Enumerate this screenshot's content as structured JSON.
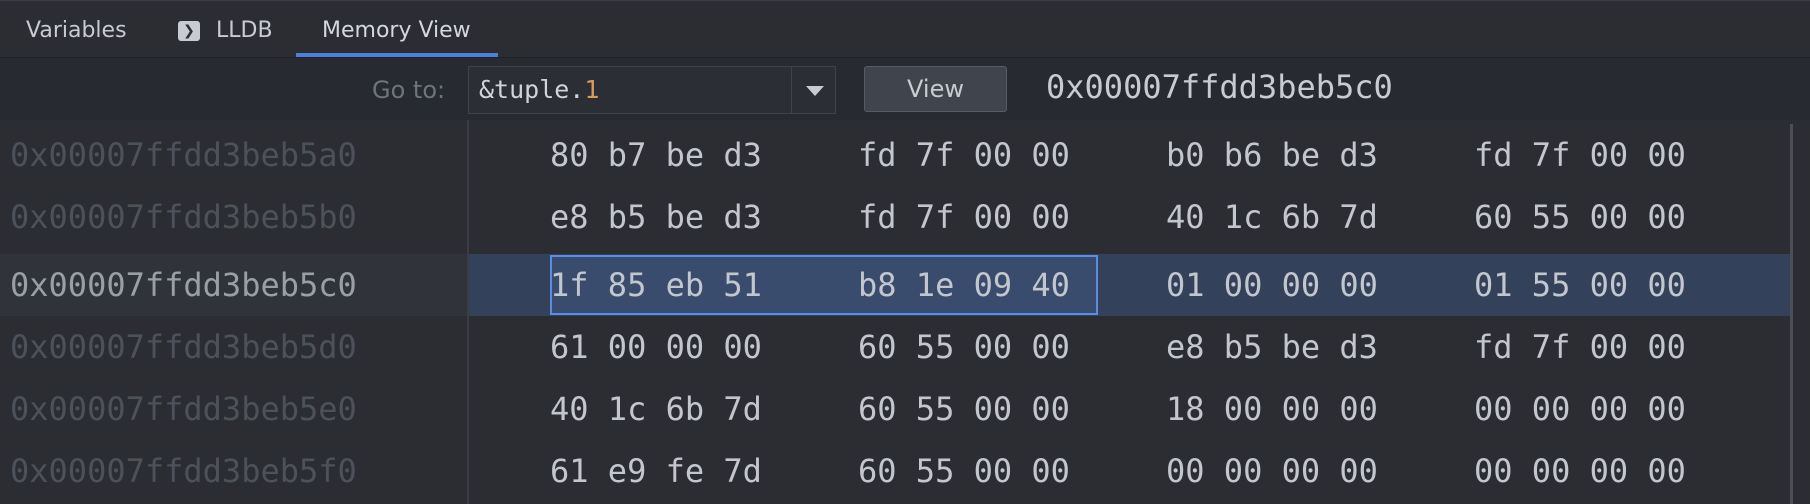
{
  "tabs": [
    {
      "label": "Variables"
    },
    {
      "label": "LLDB",
      "icon": "terminal-icon"
    },
    {
      "label": "Memory View",
      "active": true
    }
  ],
  "toolbar": {
    "goto_label": "Go to:",
    "expression_prefix": "&tuple.",
    "expression_suffix": "1",
    "view_button": "View",
    "current_address": "0x00007ffdd3beb5c0"
  },
  "colors": {
    "accent": "#4d7fd9",
    "selection_row": "#33415a",
    "selection_border": "#5b8ce6",
    "number_highlight": "#d99a5e"
  },
  "memory": {
    "rows": [
      {
        "address": "0x00007ffdd3beb5a0",
        "groups": [
          "80 b7 be d3",
          "fd 7f 00 00",
          "b0 b6 be d3",
          "fd 7f 00 00"
        ]
      },
      {
        "address": "0x00007ffdd3beb5b0",
        "groups": [
          "e8 b5 be d3",
          "fd 7f 00 00",
          "40 1c 6b 7d",
          "60 55 00 00"
        ]
      },
      {
        "address": "0x00007ffdd3beb5c0",
        "groups": [
          "1f 85 eb 51",
          "b8 1e 09 40",
          "01 00 00 00",
          "01 55 00 00"
        ],
        "selected": true
      },
      {
        "address": "0x00007ffdd3beb5d0",
        "groups": [
          "61 00 00 00",
          "60 55 00 00",
          "e8 b5 be d3",
          "fd 7f 00 00"
        ]
      },
      {
        "address": "0x00007ffdd3beb5e0",
        "groups": [
          "40 1c 6b 7d",
          "60 55 00 00",
          "18 00 00 00",
          "00 00 00 00"
        ]
      },
      {
        "address": "0x00007ffdd3beb5f0",
        "groups": [
          "61 e9 fe 7d",
          "60 55 00 00",
          "00 00 00 00",
          "00 00 00 00"
        ]
      }
    ]
  }
}
